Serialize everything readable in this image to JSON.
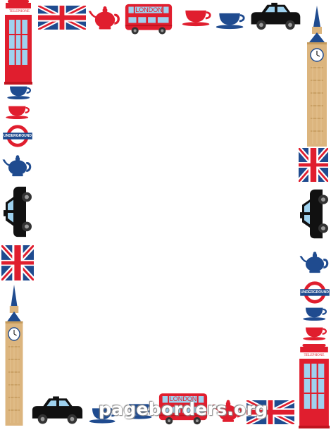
{
  "frame": {
    "colors": {
      "red": "#e01e2e",
      "navy": "#1f4b8f",
      "black": "#111111",
      "tan": "#dcb57e",
      "glass": "#9fd2ef",
      "white": "#ffffff"
    },
    "icons": [
      "telephone-box-icon",
      "union-jack-icon",
      "teapot-icon",
      "london-bus-icon",
      "teacup-icon",
      "london-taxi-icon",
      "big-ben-icon",
      "underground-sign-icon"
    ]
  },
  "labels": {
    "telephone": "TELEPHONE",
    "bus": "LONDON",
    "underground": "UNDERGROUND"
  },
  "watermark": "pageborders.org"
}
